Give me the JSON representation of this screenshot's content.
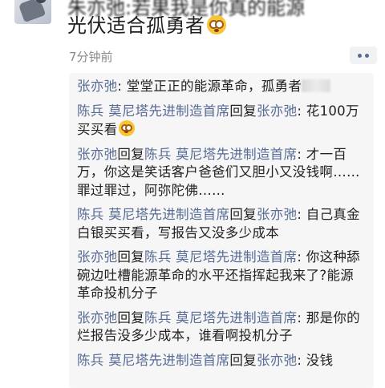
{
  "post": {
    "top_line_blurred": "朱亦弛:若果我是你真的能源",
    "text": "光伏适合孤勇者",
    "emoji_icon": "flushed-face-icon",
    "time": "7分钟前"
  },
  "comments": [
    {
      "author": "张亦弛",
      "text": ": 堂堂正正的能源革命，孤勇者"
    },
    {
      "author": "陈兵 莫尼塔先进制造首席",
      "reply_word": "回复",
      "target": "张亦弛",
      "text": ": 花100万买买看"
    },
    {
      "author": "张亦弛",
      "reply_word": "回复",
      "target": "陈兵 莫尼塔先进制造首席",
      "text": ": 才一百万，你这是笑话客户爸爸们又胆小又没钱啊……罪过罪过，阿弥陀佛……"
    },
    {
      "author": "陈兵 莫尼塔先进制造首席",
      "reply_word": "回复",
      "target": "张亦弛",
      "text": ": 自己真金白银买买看，写报告又没多少成本"
    },
    {
      "author": "张亦弛",
      "reply_word": "回复",
      "target": "陈兵 莫尼塔先进制造首席",
      "text": ": 你这种舔碗边吐槽能源革命的水平还指挥起我来了?能源革命投机分子"
    },
    {
      "author": "张亦弛",
      "reply_word": "回复",
      "target": "陈兵 莫尼塔先进制造首席",
      "text": ": 那是你的烂报告没多少成本，谁看啊投机分子"
    },
    {
      "author": "陈兵 莫尼塔先进制造首席",
      "reply_word": "回复",
      "target": "张亦弛",
      "text": ": 没钱"
    }
  ],
  "colors": {
    "name_link": "#576b95",
    "comment_bg": "#f6f6f6",
    "time": "#8a8a8a"
  }
}
